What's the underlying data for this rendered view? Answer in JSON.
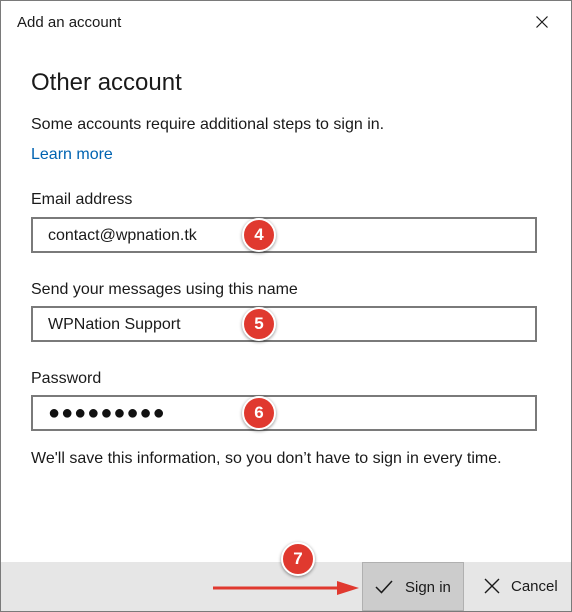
{
  "window": {
    "title": "Add an account",
    "close_icon": "close-icon"
  },
  "content": {
    "heading": "Other account",
    "subtext": "Some accounts require additional steps to sign in.",
    "learn_more": "Learn more",
    "note": "We'll save this information, so you don’t have to sign in every time."
  },
  "fields": {
    "email": {
      "label": "Email address",
      "value": "contact@wpnation.tk"
    },
    "name": {
      "label": "Send your messages using this name",
      "value": "WPNation Support"
    },
    "password": {
      "label": "Password",
      "value": "●●●●●●●●●"
    }
  },
  "annotations": {
    "step4": "4",
    "step5": "5",
    "step6": "6",
    "step7": "7",
    "color": "#e0392f"
  },
  "footer": {
    "signin_label": "Sign in",
    "signin_icon": "checkmark-icon",
    "cancel_label": "Cancel",
    "cancel_icon": "close-icon"
  }
}
